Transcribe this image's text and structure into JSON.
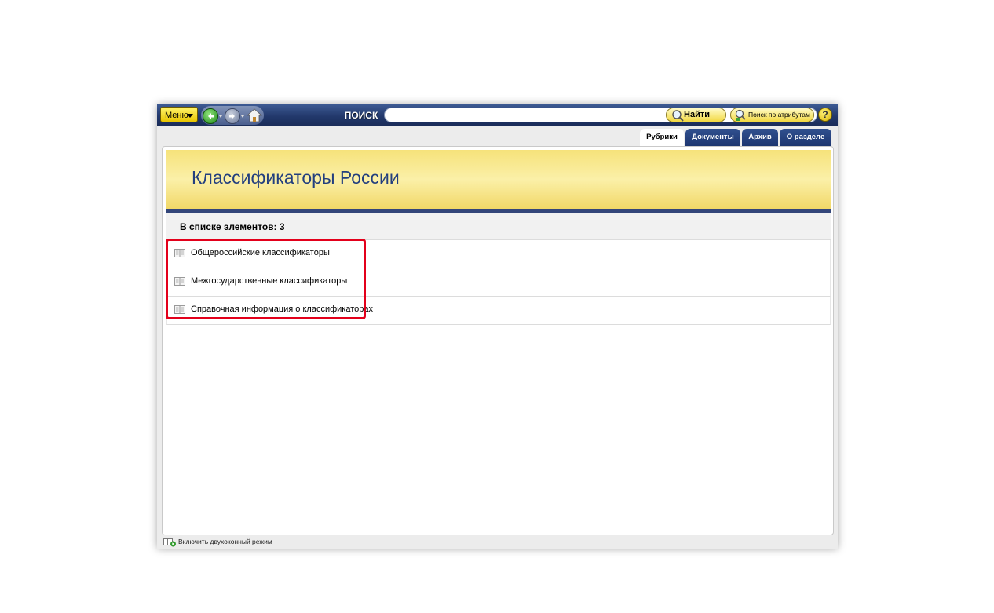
{
  "toolbar": {
    "menu_label": "Меню",
    "search_label": "ПОИСК",
    "search_value": "",
    "find_label": "Найти",
    "attr_search_label": "Поиск по атрибутам",
    "help_label": "?"
  },
  "tabs": [
    {
      "label": "Рубрики",
      "active": true
    },
    {
      "label": "Документы",
      "active": false
    },
    {
      "label": "Архив",
      "active": false
    },
    {
      "label": "О разделе",
      "active": false
    }
  ],
  "page": {
    "title": "Классификаторы России",
    "count_label": "В списке элементов: 3"
  },
  "items": [
    {
      "label": "Общероссийские классификаторы"
    },
    {
      "label": "Межгосударственные классификаторы"
    },
    {
      "label": "Справочная информация о классификаторах"
    }
  ],
  "status": {
    "dual_window_label": "Включить двухоконный режим"
  },
  "colors": {
    "toolbar": "#22386b",
    "title": "#233f7e",
    "highlight": "#e3001b",
    "banner": "#f6e27a"
  }
}
